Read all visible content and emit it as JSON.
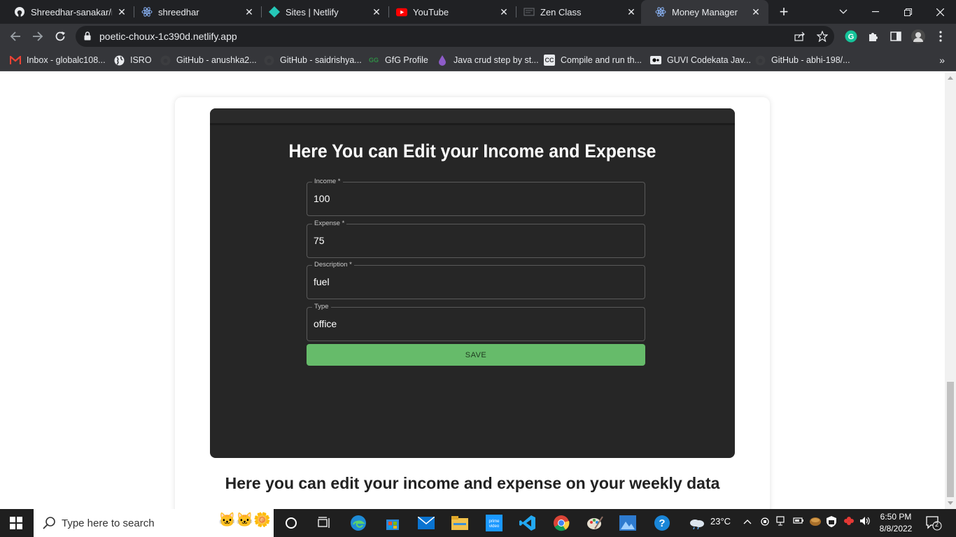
{
  "browser": {
    "tabs": [
      {
        "title": "Shreedhar-sanakar/mo",
        "icon": "github-icon",
        "active": false
      },
      {
        "title": "shreedhar",
        "icon": "react-icon",
        "active": false
      },
      {
        "title": "Sites | Netlify",
        "icon": "netlify-icon",
        "active": false
      },
      {
        "title": "YouTube",
        "icon": "youtube-icon",
        "active": false
      },
      {
        "title": "Zen Class",
        "icon": "zen-class-icon",
        "active": false
      },
      {
        "title": "Money Manager",
        "icon": "react-icon",
        "active": true
      }
    ],
    "url": "poetic-choux-1c390d.netlify.app",
    "bookmarks": [
      {
        "label": "Inbox - globalc108...",
        "icon": "gmail-icon"
      },
      {
        "label": "ISRO",
        "icon": "globe-icon"
      },
      {
        "label": "GitHub - anushka2...",
        "icon": "github-icon"
      },
      {
        "label": "GitHub - saidrishya...",
        "icon": "github-icon"
      },
      {
        "label": "GfG Profile",
        "icon": "gfg-icon"
      },
      {
        "label": "Java crud step by st...",
        "icon": "drop-icon"
      },
      {
        "label": "Compile and run th...",
        "icon": "cc-icon"
      },
      {
        "label": "GUVI Codekata Jav...",
        "icon": "guvi-icon"
      },
      {
        "label": "GitHub - abhi-198/...",
        "icon": "github-icon"
      }
    ]
  },
  "page": {
    "form_title": "Here You can Edit your Income and Expense",
    "fields": [
      {
        "label": "Income *",
        "value": "100"
      },
      {
        "label": "Expense *",
        "value": "75"
      },
      {
        "label": "Description *",
        "value": "fuel"
      },
      {
        "label": "Type",
        "value": "office"
      }
    ],
    "save_label": "SAVE",
    "footer_text": "Here you can edit your income and expense on your weekly data"
  },
  "taskbar": {
    "search_placeholder": "Type here to search",
    "temperature": "23°C",
    "time": "6:50 PM",
    "date": "8/8/2022",
    "notification_count": "2"
  },
  "colors": {
    "panel_bg": "#262626",
    "save_button": "#66bb6a",
    "chrome_dark": "#202124",
    "chrome_toolbar": "#35363a"
  }
}
